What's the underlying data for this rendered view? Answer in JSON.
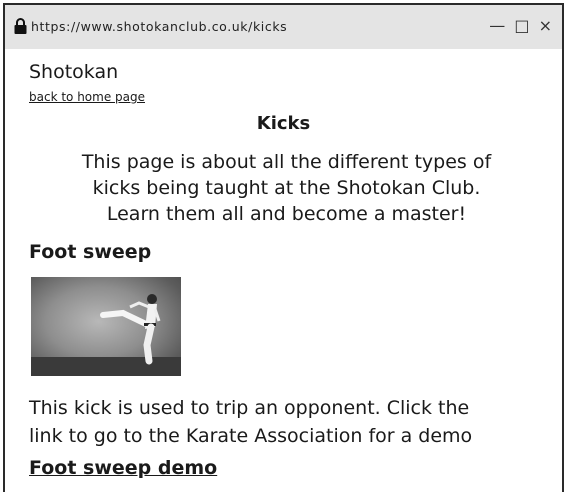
{
  "browser": {
    "url": "https://www.shotokanclub.co.uk/kicks",
    "controls": {
      "minimize": "—",
      "maximize": "□",
      "close": "×"
    }
  },
  "header": {
    "site_name": "Shotokan",
    "home_link": "back to home page"
  },
  "main": {
    "title": "Kicks",
    "intro_lines": [
      "This page is about all the different types of",
      "kicks being taught at the Shotokan Club.",
      "Learn them all and become a master!"
    ],
    "section": {
      "title": "Foot sweep",
      "description_lines": [
        "This kick is used to trip an opponent. Click the",
        "link to go to the Karate Association for a demo"
      ],
      "demo_link": "Foot sweep demo"
    }
  }
}
